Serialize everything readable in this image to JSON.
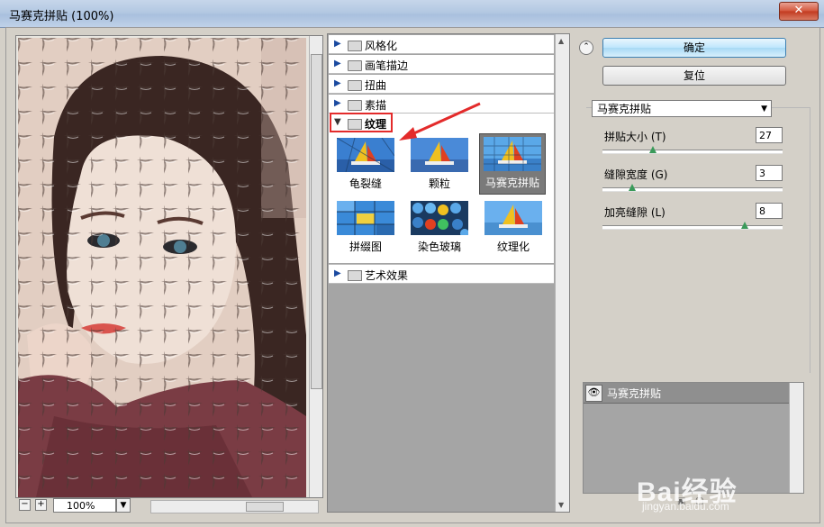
{
  "window": {
    "title": "马赛克拼贴 (100%)",
    "close_glyph": "✕"
  },
  "preview": {
    "zoom": "100%",
    "zoom_out": "−",
    "zoom_in": "+"
  },
  "gallery": {
    "categories": [
      {
        "label": "风格化"
      },
      {
        "label": "画笔描边"
      },
      {
        "label": "扭曲"
      },
      {
        "label": "素描"
      }
    ],
    "open_category": "纹理",
    "thumbnails": [
      {
        "label": "龟裂缝",
        "selected": false
      },
      {
        "label": "颗粒",
        "selected": false
      },
      {
        "label": "马赛克拼贴",
        "selected": true
      },
      {
        "label": "拼缀图",
        "selected": false
      },
      {
        "label": "染色玻璃",
        "selected": false
      },
      {
        "label": "纹理化",
        "selected": false
      }
    ],
    "after_category": "艺术效果"
  },
  "buttons": {
    "ok": "确定",
    "reset": "复位"
  },
  "settings": {
    "filter": "马赛克拼贴",
    "params": [
      {
        "label": "拼贴大小 (T)",
        "value": "27",
        "level": 0.27
      },
      {
        "label": "缝隙宽度 (G)",
        "value": "3",
        "level": 0.15
      },
      {
        "label": "加亮缝隙 (L)",
        "value": "8",
        "level": 0.8
      }
    ]
  },
  "layers": [
    {
      "label": "马赛克拼贴"
    }
  ],
  "watermark": {
    "main": "Bai经验",
    "sub": "jingyan.baidu.com"
  },
  "colors": {
    "accent_red": "#e32b2b",
    "selected_thumb": "#7a7a7a",
    "knob": "#3a9a5a"
  }
}
